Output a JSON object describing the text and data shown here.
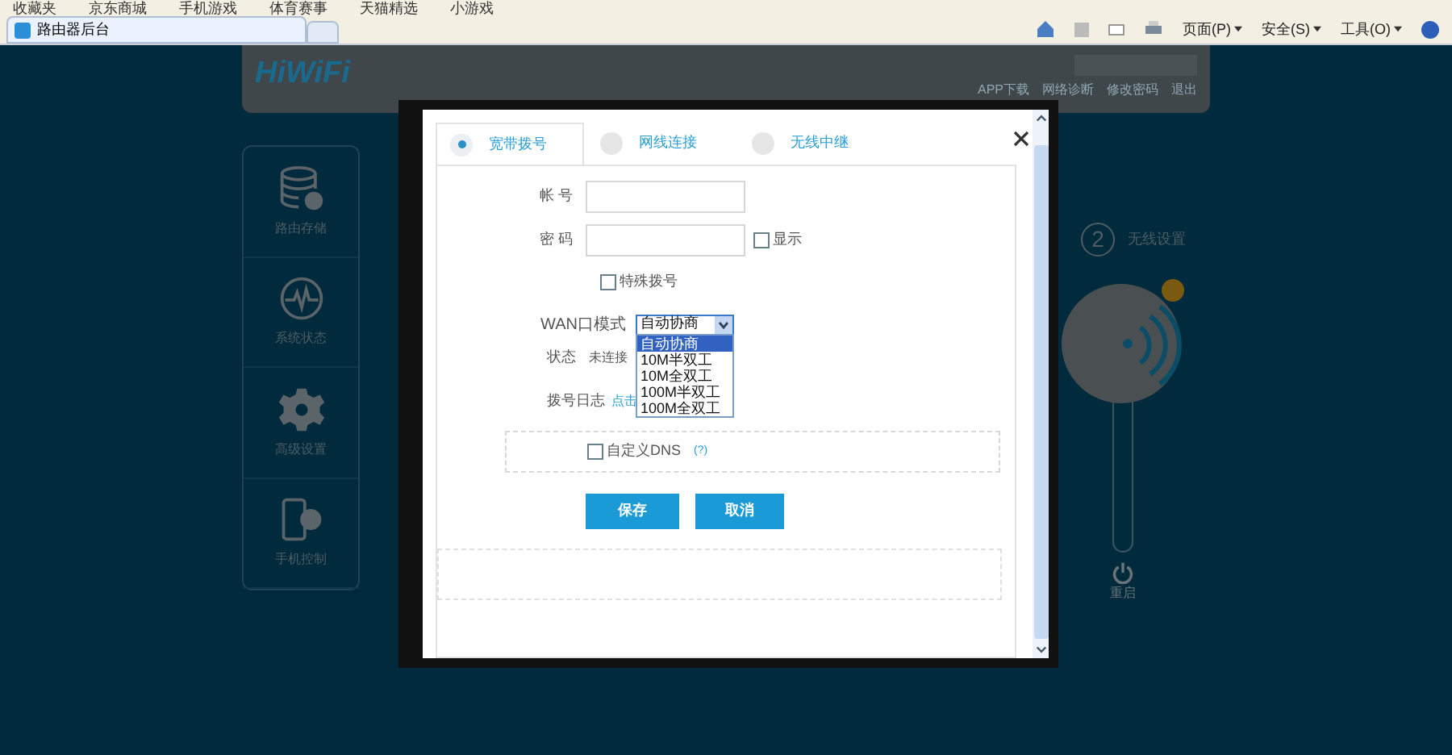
{
  "browser": {
    "favorites": [
      "收藏夹",
      "京东商城",
      "手机游戏",
      "体育赛事",
      "天猫精选",
      "小游戏"
    ],
    "tabs": [
      {
        "label": "路由器后台",
        "selected": true
      }
    ],
    "command_bar": [
      "页面(P)",
      "安全(S)",
      "工具(O)"
    ]
  },
  "header": {
    "logo": "HiWiFi",
    "links": [
      "APP下载",
      "网络诊断",
      "修改密码",
      "退出"
    ]
  },
  "sidebar": {
    "items": [
      {
        "label": "路由存储",
        "kind": "storage"
      },
      {
        "label": "系统状态",
        "kind": "status"
      },
      {
        "label": "高级设置",
        "kind": "settings"
      },
      {
        "label": "手机控制",
        "kind": "phone"
      }
    ]
  },
  "wireless_step": {
    "number": "2",
    "label": "无线设置",
    "reboot": "重启"
  },
  "dialog": {
    "tabs": [
      {
        "label": "宽带拨号",
        "selected": true
      },
      {
        "label": "网线连接",
        "selected": false
      },
      {
        "label": "无线中继",
        "selected": false
      }
    ],
    "account": {
      "label": "帐 号"
    },
    "password": {
      "label": "密 码"
    },
    "show_password": {
      "label": "显示",
      "checked": false
    },
    "special_dial": {
      "label": "特殊拨号",
      "checked": false
    },
    "wan_mode": {
      "label": "WAN口模式",
      "value": "自动协商",
      "expanded": true,
      "options": [
        {
          "label": "自动协商",
          "selected": true
        },
        {
          "label": "10M半双工",
          "selected": false
        },
        {
          "label": "10M全双工",
          "selected": false
        },
        {
          "label": "100M半双工",
          "selected": false
        },
        {
          "label": "100M全双工",
          "selected": false
        }
      ]
    },
    "status": {
      "label": "状态",
      "value": "未连接"
    },
    "dial_log": {
      "label": "拨号日志",
      "link": "点击"
    },
    "custom_dns": {
      "label": "自定义DNS",
      "checked": false,
      "help": "(?)"
    },
    "buttons": [
      "保存",
      "取消"
    ]
  }
}
